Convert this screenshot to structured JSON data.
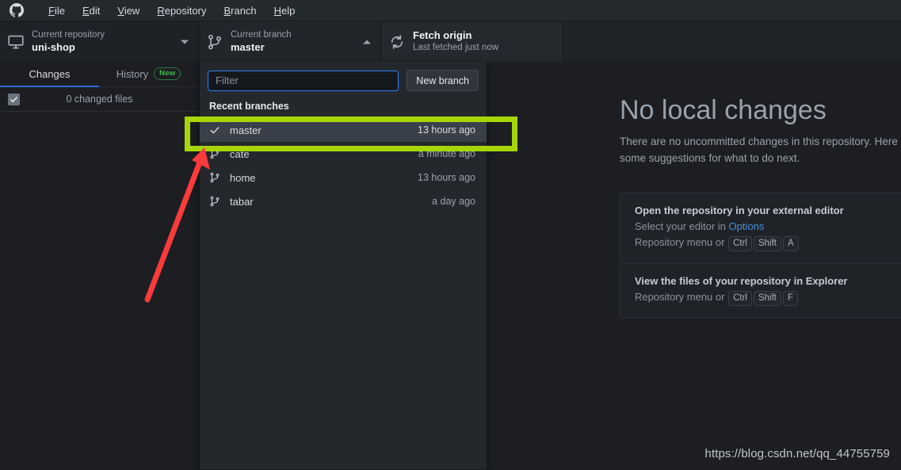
{
  "app": {
    "logo_icon": "github-mark-icon",
    "menu": [
      {
        "label": "File",
        "accesskey": "F"
      },
      {
        "label": "Edit",
        "accesskey": "E"
      },
      {
        "label": "View",
        "accesskey": "V"
      },
      {
        "label": "Repository",
        "accesskey": "R"
      },
      {
        "label": "Branch",
        "accesskey": "B"
      },
      {
        "label": "Help",
        "accesskey": "H"
      }
    ]
  },
  "toolbar": {
    "repository": {
      "icon": "desktop-monitor-icon",
      "label": "Current repository",
      "value": "uni-shop",
      "caret": "chevron-down-icon"
    },
    "branch": {
      "icon": "git-branch-icon",
      "label": "Current branch",
      "value": "master",
      "caret": "chevron-up-icon"
    },
    "fetch": {
      "icon": "sync-refresh-icon",
      "title": "Fetch origin",
      "subtitle": "Last fetched just now"
    }
  },
  "sidebar": {
    "tabs": [
      {
        "label": "Changes",
        "active": true,
        "badge": ""
      },
      {
        "label": "History",
        "active": false,
        "badge": "New"
      }
    ],
    "changes_summary": {
      "checkbox_icon": "checkmark-icon",
      "label": "0 changed files"
    }
  },
  "branch_dropdown": {
    "filter": {
      "value": "",
      "placeholder": "Filter"
    },
    "new_branch_label": "New branch",
    "section_title": "Recent branches",
    "branches": [
      {
        "name": "master",
        "time": "13 hours ago",
        "icon": "checkmark-icon",
        "selected": true
      },
      {
        "name": "cate",
        "time": "a minute ago",
        "icon": "git-branch-icon",
        "selected": false
      },
      {
        "name": "home",
        "time": "13 hours ago",
        "icon": "git-branch-icon",
        "selected": false
      },
      {
        "name": "tabar",
        "time": "a day ago",
        "icon": "git-branch-icon",
        "selected": false
      }
    ]
  },
  "main": {
    "title": "No local changes",
    "subtitle": "There are no uncommitted changes in this repository. Here are some suggestions for what to do next.",
    "suggestions": [
      {
        "title": "Open the repository in your external editor",
        "line_prefix": "Select your editor in ",
        "link": "Options",
        "hint_prefix": "Repository menu or ",
        "keys": [
          "Ctrl",
          "Shift",
          "A"
        ]
      },
      {
        "title": "View the files of your repository in Explorer",
        "line_prefix": "",
        "link": "",
        "hint_prefix": "Repository menu or ",
        "keys": [
          "Ctrl",
          "Shift",
          "F"
        ]
      }
    ]
  },
  "annotations": {
    "highlight_color": "#a6d608",
    "arrow_color": "#fb3b3b",
    "watermark": "https://blog.csdn.net/qq_44755759"
  }
}
